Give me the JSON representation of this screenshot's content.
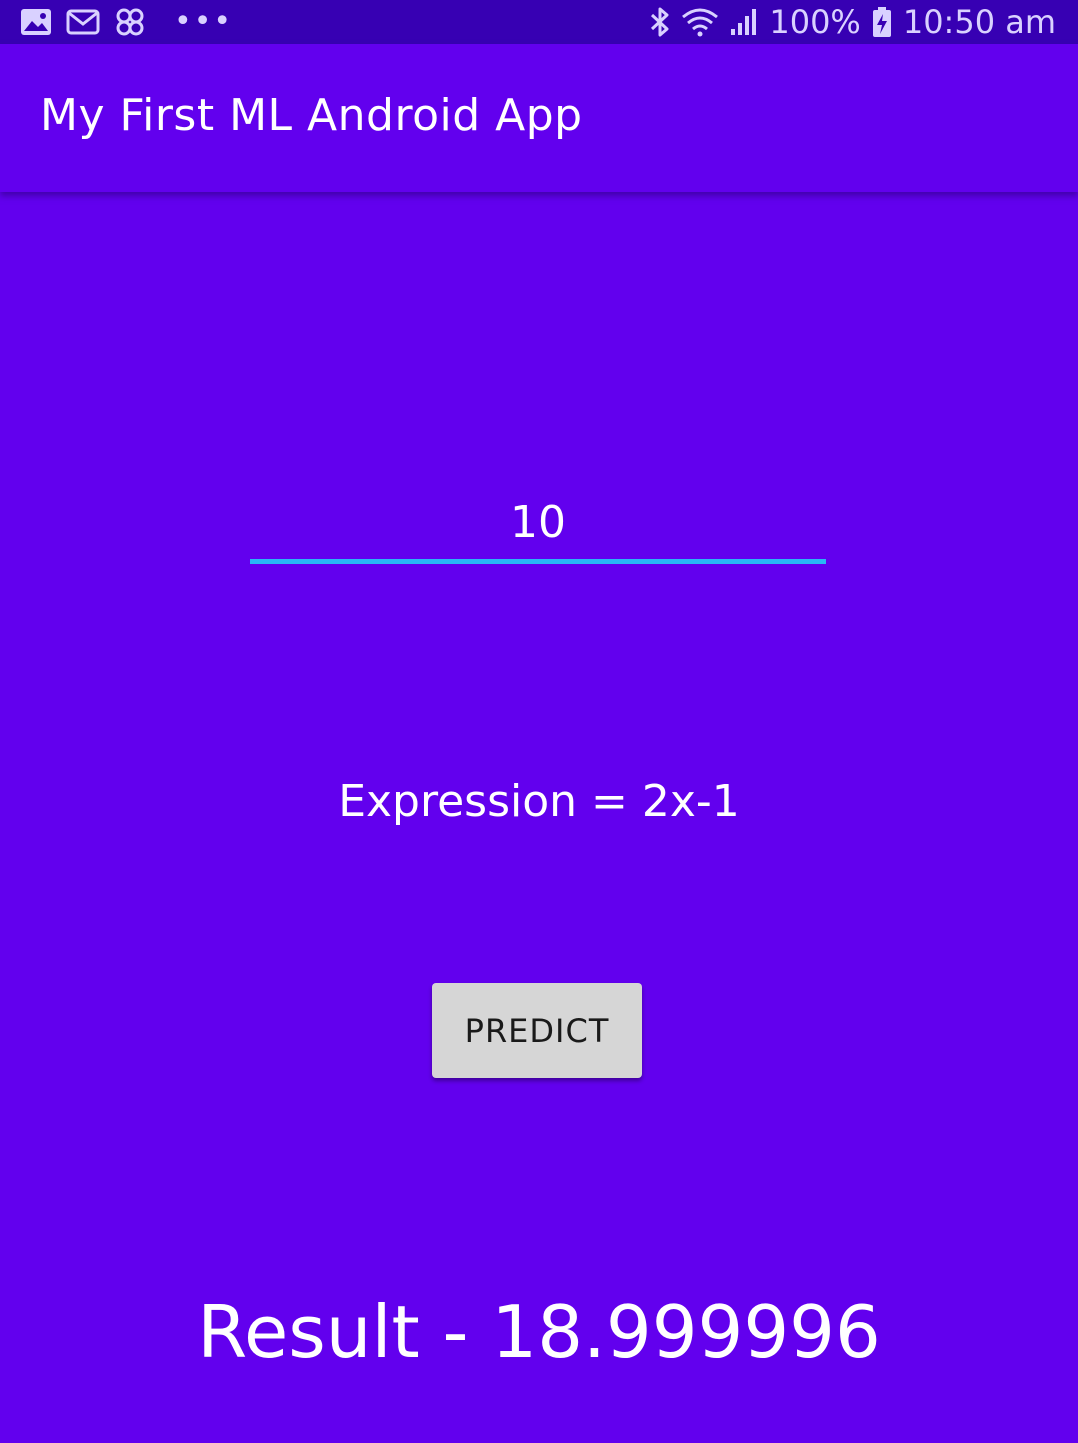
{
  "status_bar": {
    "icons_left": [
      "gallery-icon",
      "gmail-icon",
      "pinwheel-icon"
    ],
    "more_indicator": "•••",
    "battery": "100%",
    "time": "10:50 am",
    "icons_right": [
      "bluetooth-icon",
      "wifi-icon",
      "signal-icon",
      "battery-charging-icon"
    ]
  },
  "app_bar": {
    "title": "My First ML Android App"
  },
  "main": {
    "input_value": "10",
    "expression": "Expression = 2x-1",
    "predict_label": "PREDICT",
    "result": "Result - 18.999996"
  },
  "colors": {
    "primary": "#6200ee",
    "primary_dark": "#3700b3",
    "accent_underline": "#29b6f6",
    "button_bg": "#d6d6d6"
  }
}
